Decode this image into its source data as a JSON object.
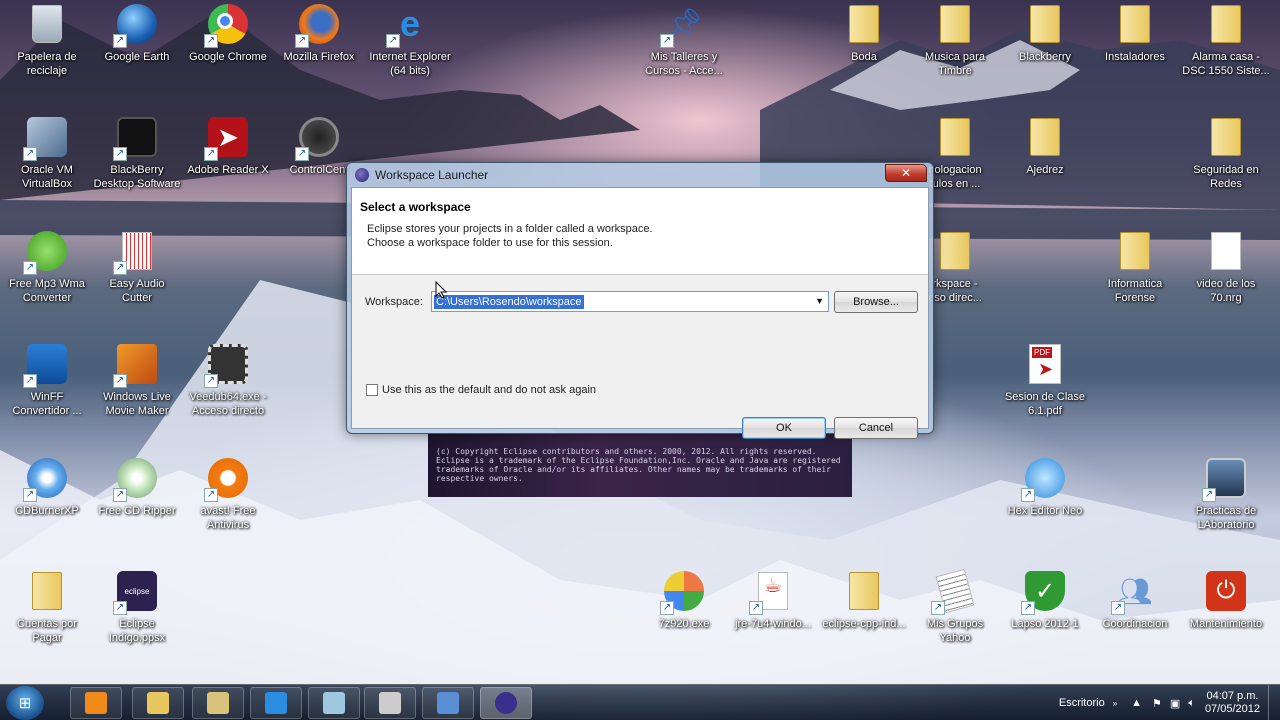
{
  "desktop": {
    "icons": [
      {
        "label": "Papelera de\nreciclaje",
        "icon": "recycle-bin-icon"
      },
      {
        "label": "Google Earth",
        "icon": "google-earth-icon"
      },
      {
        "label": "Google Chrome",
        "icon": "chrome-icon"
      },
      {
        "label": "Mozilla Firefox",
        "icon": "firefox-icon"
      },
      {
        "label": "Internet Explorer\n(64 bits)",
        "icon": "internet-explorer-icon"
      },
      {
        "label": "Mis Talleres y\nCursos - Acce...",
        "icon": "pushpin-folder-icon"
      },
      {
        "label": "Boda",
        "icon": "folder-icon"
      },
      {
        "label": "Musica para\nTimbre",
        "icon": "folder-icon"
      },
      {
        "label": "Blackberry",
        "icon": "folder-icon"
      },
      {
        "label": "Instaladores",
        "icon": "folder-icon"
      },
      {
        "label": "Alarma casa -\nDSC 1550 Siste...",
        "icon": "folder-icon"
      },
      {
        "label": "Oracle VM\nVirtualBox",
        "icon": "virtualbox-icon"
      },
      {
        "label": "BlackBerry\nDesktop Software",
        "icon": "blackberry-icon"
      },
      {
        "label": "Adobe Reader X",
        "icon": "adobe-reader-icon"
      },
      {
        "label": "ControlCent",
        "icon": "control-center-icon"
      },
      {
        "label": "nologacion\ntulos en ...",
        "icon": "folder-icon"
      },
      {
        "label": "Ajedrez",
        "icon": "folder-icon"
      },
      {
        "label": "Seguridad en\nRedes",
        "icon": "folder-icon"
      },
      {
        "label": "Free Mp3 Wma\nConverter",
        "icon": "mp3-converter-icon"
      },
      {
        "label": "Easy Audio\nCutter",
        "icon": "audio-cutter-icon"
      },
      {
        "label": "rkspace -\neso direc...",
        "icon": "folder-icon"
      },
      {
        "label": "Informatica\nForense",
        "icon": "folder-icon"
      },
      {
        "label": "video de los\n70.nrg",
        "icon": "file-icon"
      },
      {
        "label": "WinFF\nConvertidor ...",
        "icon": "winff-icon"
      },
      {
        "label": "Windows Live\nMovie Maker",
        "icon": "movie-maker-icon"
      },
      {
        "label": "Veedub64.exe -\nAcceso directo",
        "icon": "film-gear-icon"
      },
      {
        "label": "Sesion de Clase\n6.1.pdf",
        "icon": "pdf-icon"
      },
      {
        "label": "CDBurnerXP",
        "icon": "cdburner-icon"
      },
      {
        "label": "Free CD Ripper",
        "icon": "cd-ripper-icon"
      },
      {
        "label": "avast! Free\nAntivirus",
        "icon": "avast-icon"
      },
      {
        "label": "Hex Editor Neo",
        "icon": "hex-editor-icon"
      },
      {
        "label": "Practicas de\nLAboratorio",
        "icon": "computer-icon"
      },
      {
        "label": "Cuentas por\nPagar",
        "icon": "folder-icon"
      },
      {
        "label": "Eclipse\nIndigo.ppsx",
        "icon": "eclipse-ppsx-icon"
      },
      {
        "label": "7z920.exe",
        "icon": "installer-icon"
      },
      {
        "label": "jre-7u4-windo...",
        "icon": "java-icon"
      },
      {
        "label": "eclipse-cpp-ind...",
        "icon": "folder-icon"
      },
      {
        "label": "Mis Grupos\nYahoo",
        "icon": "newspaper-icon"
      },
      {
        "label": "Lapso 2012-1",
        "icon": "shield-check-icon"
      },
      {
        "label": "Coordinacion",
        "icon": "users-icon"
      },
      {
        "label": "Mantenimiento",
        "icon": "power-icon"
      }
    ]
  },
  "splash": {
    "copyright": "(c) Copyright Eclipse contributors and others. 2000, 2012.  All rights reserved. Eclipse is a trademark of the Eclipse Foundation,Inc. Oracle and Java are registered trademarks of Oracle and/or its affiliates. Other names may be trademarks of their respective owners."
  },
  "dialog": {
    "title": "Workspace Launcher",
    "close_glyph": "✕",
    "header_title": "Select a workspace",
    "header_desc_1": "Eclipse stores your projects in a folder called a workspace.",
    "header_desc_2": "Choose a workspace folder to use for this session.",
    "workspace_label": "Workspace:",
    "workspace_value": "C:\\Users\\Rosendo\\workspace",
    "browse_label": "Browse...",
    "default_checkbox_label": "Use this as the default and do not ask again",
    "default_checked": false,
    "ok_label": "OK",
    "cancel_label": "Cancel"
  },
  "taskbar": {
    "start_icon": "windows-logo-icon",
    "items": [
      "media-player-icon",
      "explorer-folder-icon",
      "network-folder-icon",
      "internet-explorer-icon",
      "glass-window-icon",
      "film-window-icon",
      "remote-desktop-icon",
      "eclipse-icon"
    ],
    "tray_label": "Escritorio",
    "time": "04:07 p.m.",
    "date": "07/05/2012"
  }
}
